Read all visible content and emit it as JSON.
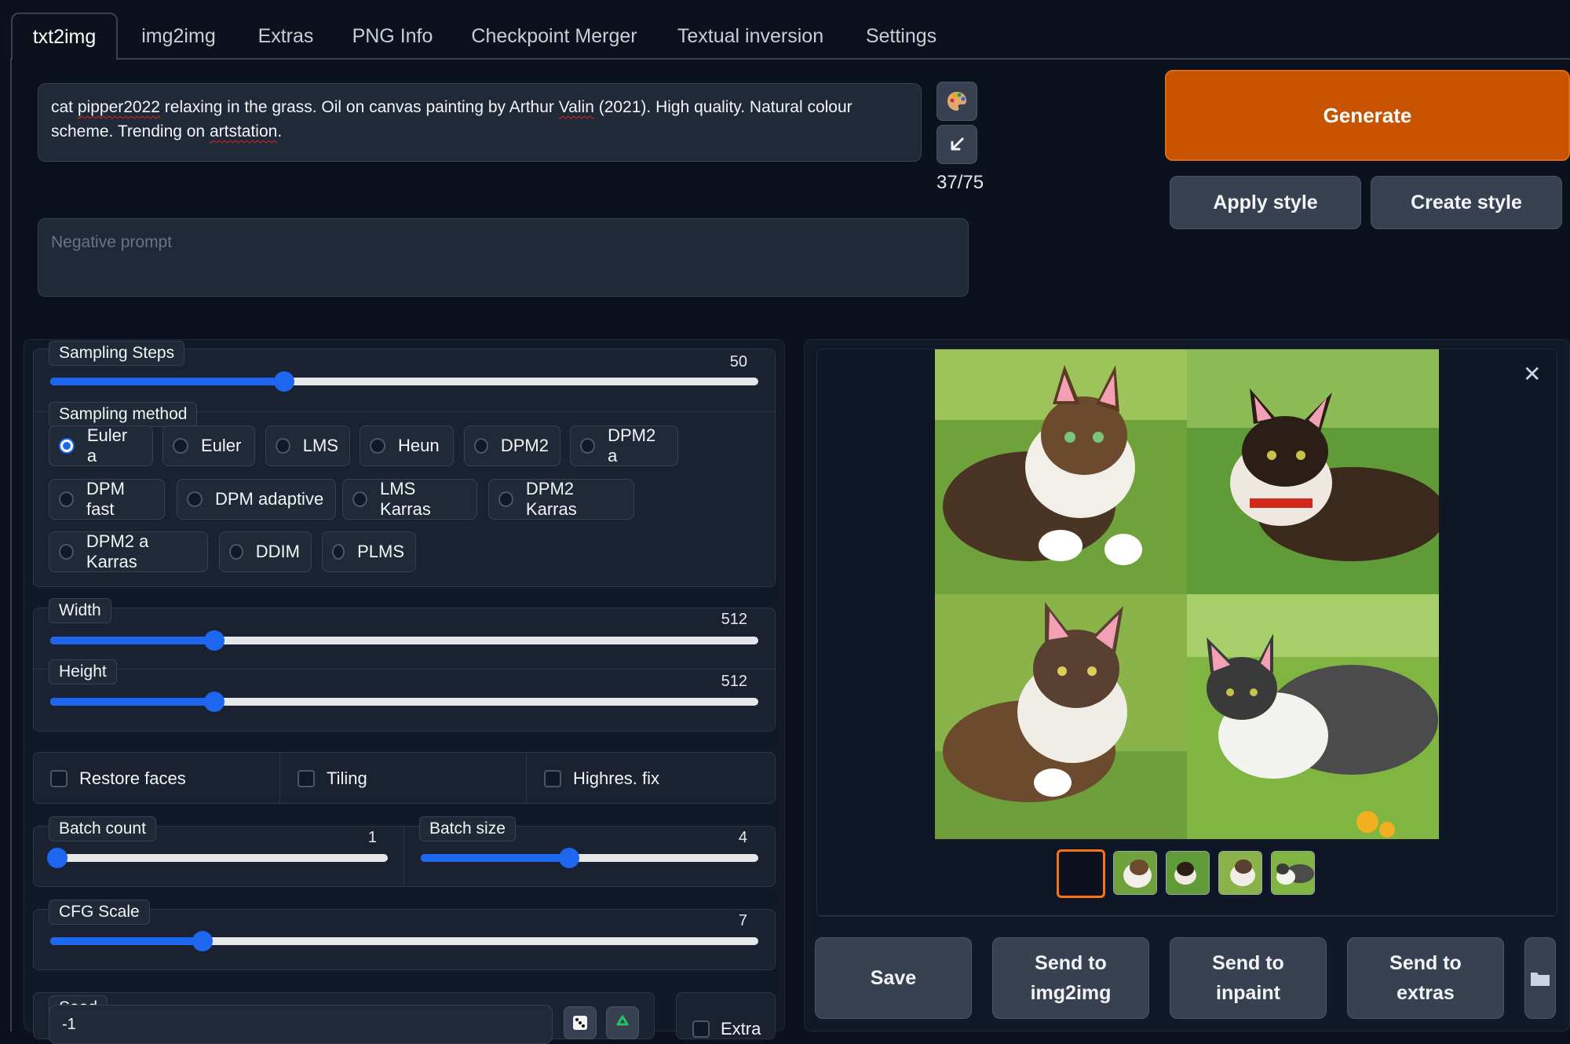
{
  "tabs": [
    {
      "label": "txt2img",
      "active": true
    },
    {
      "label": "img2img"
    },
    {
      "label": "Extras"
    },
    {
      "label": "PNG Info"
    },
    {
      "label": "Checkpoint Merger"
    },
    {
      "label": "Textual inversion"
    },
    {
      "label": "Settings"
    }
  ],
  "prompt": {
    "text_line1_a": "cat ",
    "text_line1_b": "pipper2022",
    "text_line1_c": " relaxing in the grass. Oil on canvas painting by Arthur ",
    "text_line1_d": "Valin",
    "text_line1_e": " (2021). High quality. Natural colour",
    "text_line2_a": "scheme. Trending on ",
    "text_line2_b": "artstation",
    "text_line2_c": ".",
    "token_counter": "37/75"
  },
  "negative_prompt": {
    "placeholder": "Negative prompt"
  },
  "icons": {
    "paint": "palette-icon",
    "arrow": "arrow-down-left-icon",
    "close": "close-icon",
    "dice": "dice-icon",
    "recycle": "recycle-icon",
    "folder": "folder-icon"
  },
  "actions": {
    "generate": "Generate",
    "apply_style": "Apply style",
    "create_style": "Create style"
  },
  "sampling_steps": {
    "label": "Sampling Steps",
    "value": "50",
    "fraction": 0.33
  },
  "sampling_method": {
    "label": "Sampling method",
    "selected": "Euler a",
    "options": [
      "Euler a",
      "Euler",
      "LMS",
      "Heun",
      "DPM2",
      "DPM2 a",
      "DPM fast",
      "DPM adaptive",
      "LMS Karras",
      "DPM2 Karras",
      "DPM2 a Karras",
      "DDIM",
      "PLMS"
    ]
  },
  "width": {
    "label": "Width",
    "value": "512",
    "fraction": 0.232
  },
  "height": {
    "label": "Height",
    "value": "512",
    "fraction": 0.232
  },
  "checkboxes": {
    "restore_faces": "Restore faces",
    "tiling": "Tiling",
    "highres_fix": "Highres. fix"
  },
  "batch_count": {
    "label": "Batch count",
    "value": "1",
    "fraction": 0.0
  },
  "batch_size": {
    "label": "Batch size",
    "value": "4",
    "fraction": 0.44
  },
  "cfg_scale": {
    "label": "CFG Scale",
    "value": "7",
    "fraction": 0.215
  },
  "seed": {
    "label": "Seed",
    "value": "-1",
    "extra_label": "Extra"
  },
  "output_actions": {
    "save": "Save",
    "send_img2img_l1": "Send to",
    "send_img2img_l2": "img2img",
    "send_inpaint_l1": "Send to",
    "send_inpaint_l2": "inpaint",
    "send_extras_l1": "Send to",
    "send_extras_l2": "extras"
  },
  "colors": {
    "accent": "#1d66f0",
    "generate": "#c75300",
    "background": "#0c111e",
    "selected_thumb_border": "#f97316"
  }
}
